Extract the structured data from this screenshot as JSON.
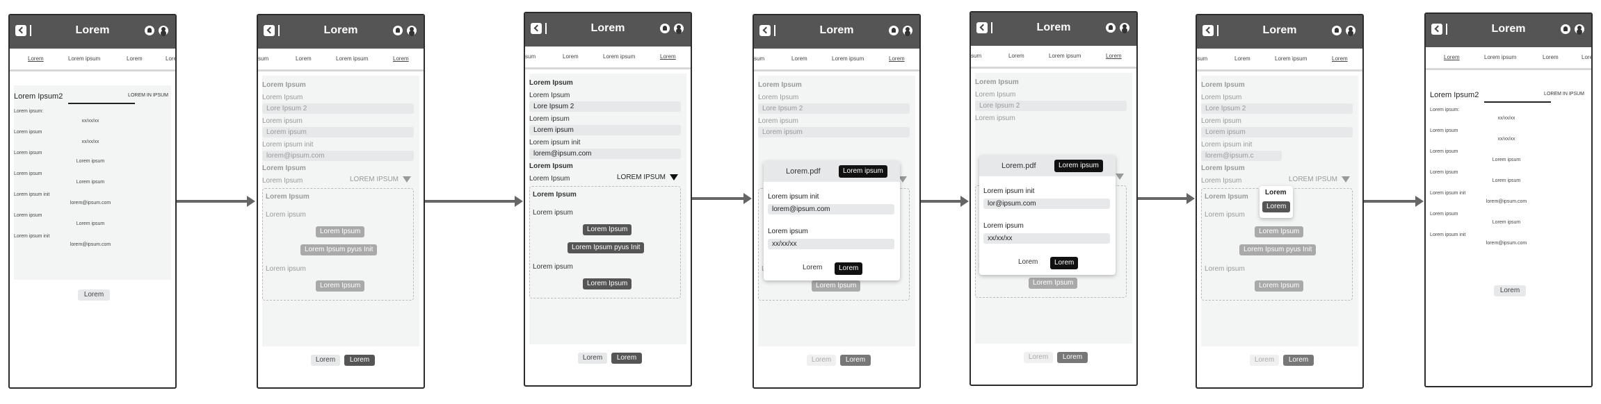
{
  "screens": {
    "s1": {
      "title": "Lorem",
      "tabs": [
        "Lorem",
        "Lorem ipsum",
        "Lorem",
        "Lore"
      ],
      "heading": "Lorem Ipsum2",
      "heading_right": "LOREM IN IPSUM",
      "rows": [
        {
          "label": "Lorem ipsum:",
          "value": "xx/xx/xx"
        },
        {
          "label": "Lorem ipsum",
          "value": "xx/xx/xx"
        },
        {
          "label": "Lorem ipsum",
          "value": "Lorem ipsum"
        },
        {
          "label": "Lorem ipsum",
          "value": "Lorem ipsum"
        },
        {
          "label": "Lorem ipsum init",
          "value": "lorem@ipsum.com"
        },
        {
          "label": "Lorem ipsum",
          "value": "Lorem ipsum"
        },
        {
          "label": "Lorem ipsum init",
          "value": "lorem@ipsum.com"
        }
      ],
      "button": "Lorem"
    },
    "form": {
      "title": "Lorem",
      "tabs": [
        "sum",
        "Lorem",
        "Lorem ipsum",
        "Lorem"
      ],
      "section": "Lorem Ipsum",
      "label1": "Lorem Ipsum",
      "field1": "Lore Ipsum 2",
      "label2": "Lorem ipsum",
      "field2": "Lorem ipsum",
      "label3": "Lorem ipsum init",
      "field3": "lorem@ipsum.com",
      "section2": "Lorem Ipsum",
      "select_label": "Lorem Ipsum",
      "select_value": "LOREM IPSUM",
      "upload_title": "Lorem Ipsum",
      "upload_label": "Lorem ipsum",
      "upload_btn": "Lorem Ipsum",
      "upload_btn2": "Lorem Ipsum pyus Init",
      "upload_label2": "Lorem ipsum",
      "upload_btn3": "Lorem Ipsum",
      "footer_left": "Lorem",
      "footer_right": "Lorem"
    },
    "s4_overlay": {
      "file": "Lorem.pdf",
      "file_btn": "Lorem ipsum",
      "label1": "Lorem ipsum init",
      "field1": "lorem@ipsum.com",
      "label2": "Lorem ipsum",
      "field2": "xx/xx/xx",
      "btn_left": "Lorem",
      "btn_right": "Lorem"
    },
    "s5_overlay": {
      "file": "Lorem.pdf",
      "file_btn": "Lorem ipsum",
      "label1": "Lorem ipsum init",
      "field1": "lor@ipsum.com",
      "label2": "Lorem ipsum",
      "field2": "xx/xx/xx",
      "btn_left": "Lorem",
      "btn_right": "Lorem"
    },
    "s6_popup": {
      "title": "Lorem",
      "option": "Lorem",
      "field3_partial": "lorem@ipsum.c"
    },
    "s7": {
      "title": "Lorem",
      "tabs": [
        "Lorem",
        "Lorem ipsum",
        "Lorem",
        "Lorem"
      ],
      "heading": "Lorem Ipsum2",
      "heading_right": "LOREM IN IPSUM",
      "rows": [
        {
          "label": "Lorem ipsum:",
          "value": "xx/xx/xx"
        },
        {
          "label": "Lorem ipsum",
          "value": "xx/xx/xx"
        },
        {
          "label": "Lorem ipsum",
          "value": "Lorem ipsum"
        },
        {
          "label": "Lorem ipsum",
          "value": "Lorem ipsum"
        },
        {
          "label": "Lorem ipsum init",
          "value": "lorem@ipsum.com"
        },
        {
          "label": "Lorem ipsum",
          "value": "Lorem ipsum"
        },
        {
          "label": "Lorem ipsum init",
          "value": "lorem@ipsum.com"
        }
      ],
      "button": "Lorem"
    }
  },
  "colors": {
    "header": "#555555",
    "arrow": "#666666",
    "panel": "#f3f4f4",
    "dark_button": "#111111"
  }
}
